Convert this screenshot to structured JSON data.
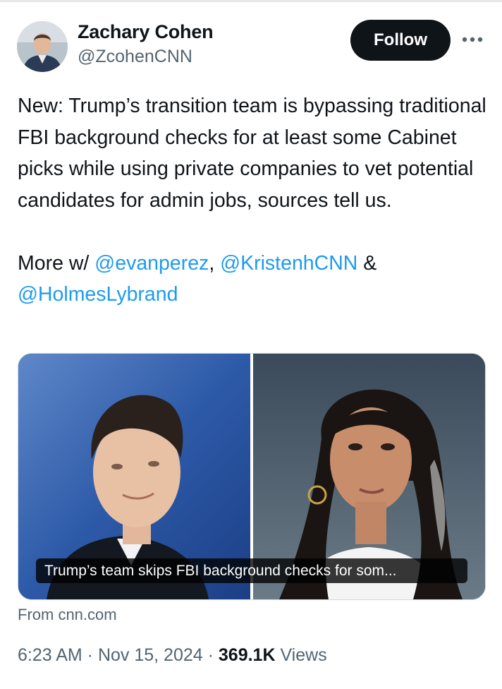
{
  "author": {
    "name": "Zachary Cohen",
    "handle": "@ZcohenCNN"
  },
  "follow_label": "Follow",
  "more_icon": "more-horizontal-icon",
  "tweet": {
    "line1": "New: Trump’s transition team is bypassing traditional FBI background checks for at least some Cabinet picks while using private companies to vet potential candidates for admin jobs, sources tell us.",
    "more_prefix": "More w/ ",
    "mention1": "@evanperez",
    "comma": ", ",
    "mention2": "@KristenhCNN",
    "amp": " & ",
    "mention3": "@HolmesLybrand"
  },
  "card": {
    "caption": "Trump’s team skips FBI background checks for som...",
    "source": "From cnn.com"
  },
  "meta": {
    "time": "6:23 AM",
    "sep1": " · ",
    "date": "Nov 15, 2024",
    "sep2": " · ",
    "views_count": "369.1K",
    "views_label": " Views"
  },
  "colors": {
    "link": "#1d9bf0",
    "text": "#0f1419",
    "secondary": "#536471",
    "follow_bg": "#0f1419"
  }
}
